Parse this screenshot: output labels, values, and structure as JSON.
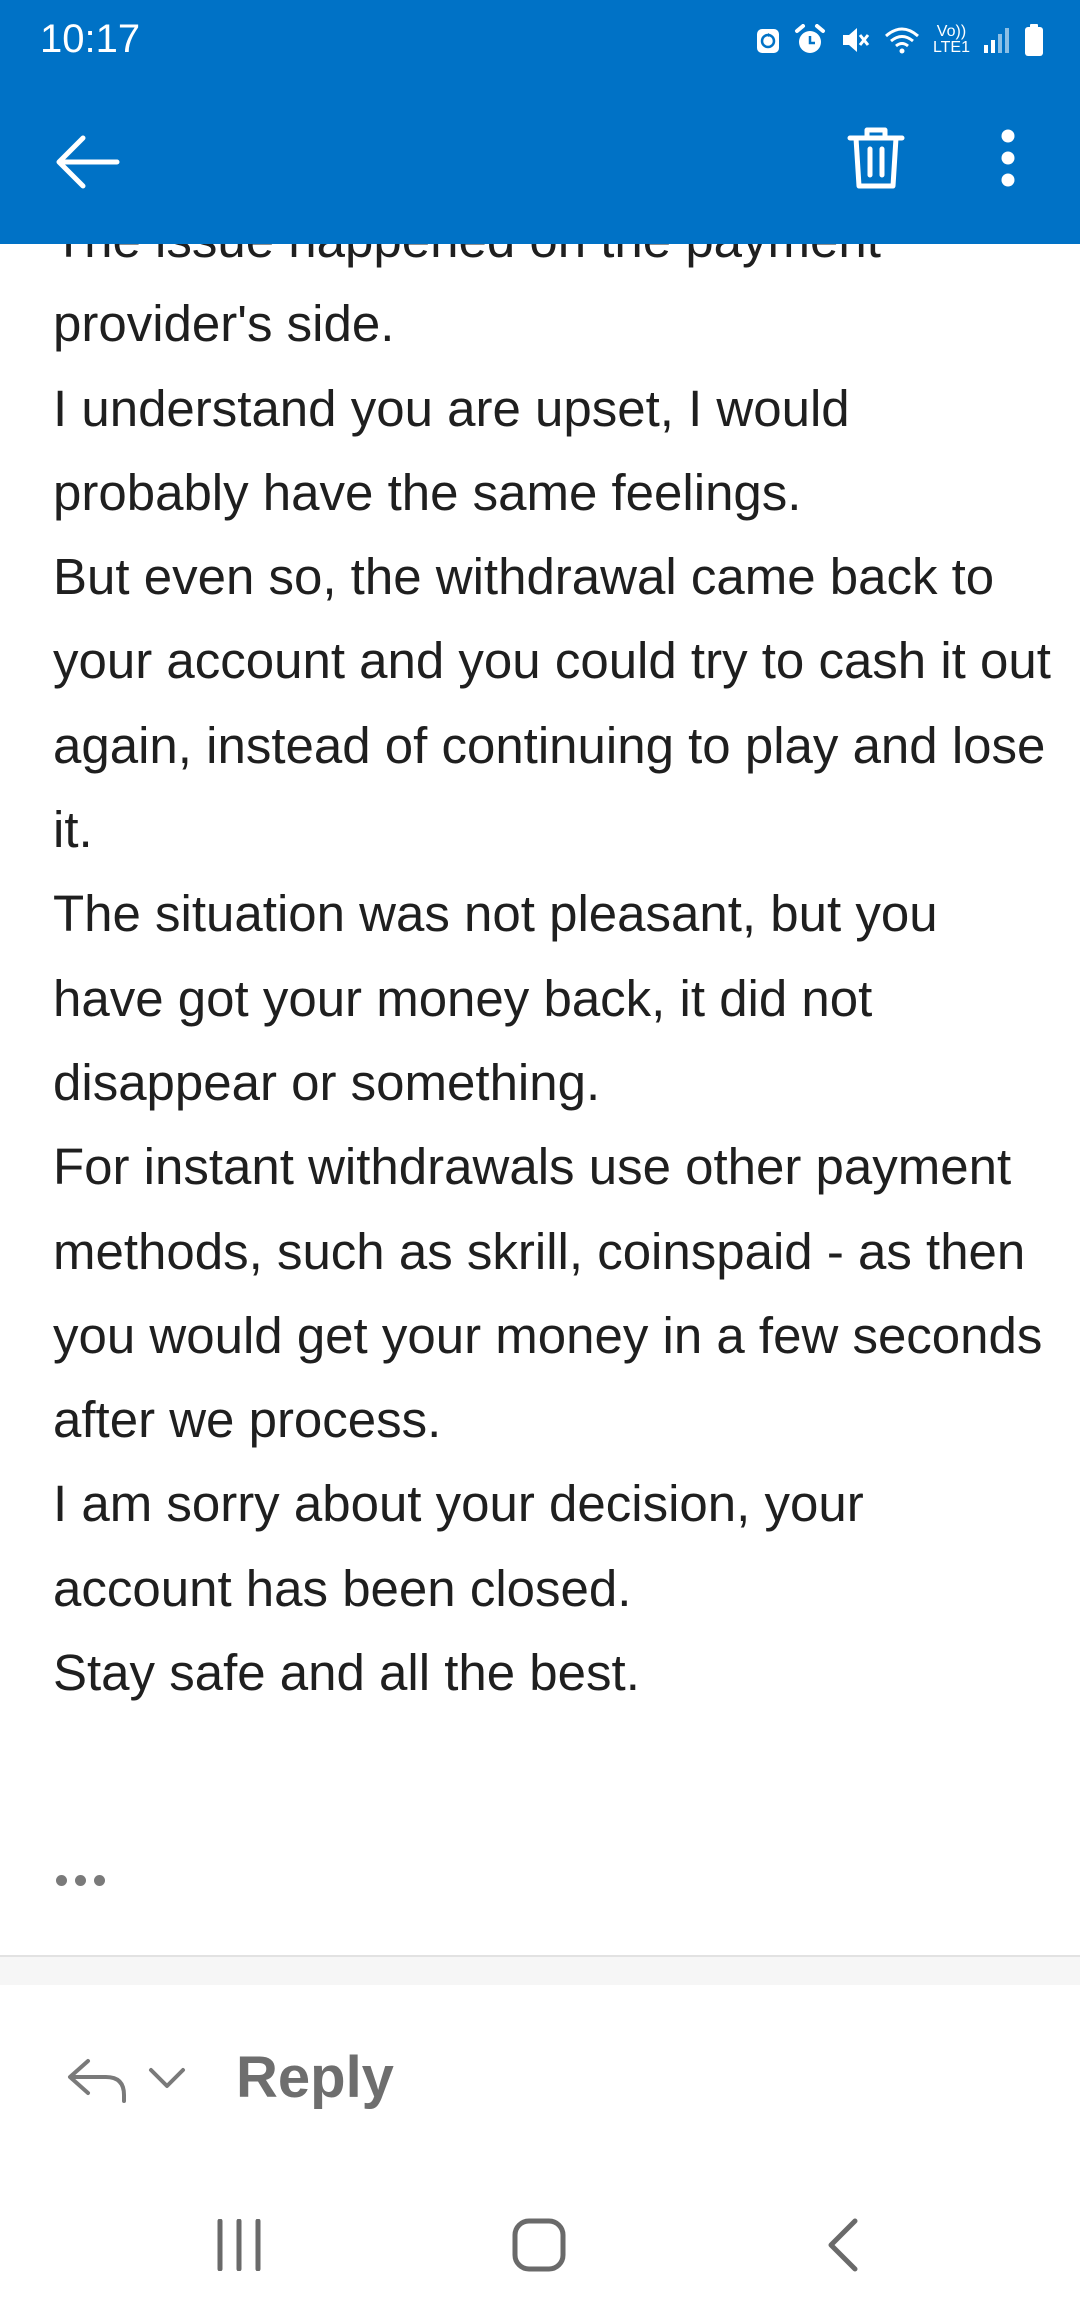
{
  "status_bar": {
    "time": "10:17",
    "network_label_top": "Vo))",
    "network_label_bottom": "LTE1",
    "icons": [
      "sync-icon",
      "alarm-icon",
      "mute-icon",
      "wifi-icon",
      "signal-icon",
      "battery-icon"
    ]
  },
  "app_bar": {
    "background_color": "#0072c6",
    "icons": [
      "back-arrow-icon",
      "trash-icon",
      "more-vert-icon"
    ]
  },
  "message": {
    "paragraphs": [
      "The issue happened on the payment provider's side.",
      "I understand you are upset, I would probably have the same feelings.",
      "But even so, the withdrawal came back to your account and you could try to cash it out again, instead of continuing to play and lose it.",
      "The situation was not pleasant, but you have got your money back, it did not disappear or something.",
      "For instant withdrawals use other payment methods, such as skrill, coinspaid - as then you would get your money in a few seconds after we process.",
      "I am sorry about your decision, your account has been closed.",
      "Stay safe and all the best."
    ],
    "text_color": "#1f1f1f"
  },
  "reply_bar": {
    "label": "Reply",
    "icons": [
      "reply-arrow-icon",
      "chevron-down-icon"
    ]
  },
  "nav_bar": {
    "icons": [
      "recents-icon",
      "home-icon",
      "nav-back-icon"
    ]
  }
}
